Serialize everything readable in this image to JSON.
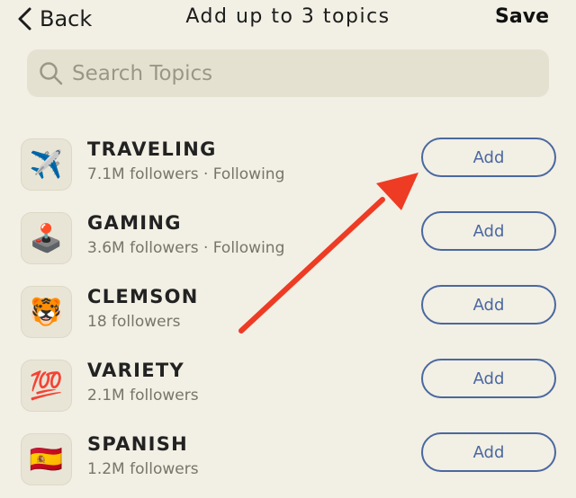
{
  "header": {
    "back_label": "Back",
    "title": "Add up to 3 topics",
    "save_label": "Save"
  },
  "search": {
    "placeholder": "Search Topics",
    "value": ""
  },
  "topics": [
    {
      "name": "TRAVELING",
      "followers": "7.1M followers · Following",
      "emoji": "✈️",
      "button": "Add"
    },
    {
      "name": "GAMING",
      "followers": "3.6M followers · Following",
      "emoji": "🕹️",
      "button": "Add"
    },
    {
      "name": "CLEMSON",
      "followers": "18 followers",
      "emoji": "🐯",
      "button": "Add"
    },
    {
      "name": "VARIETY",
      "followers": "2.1M followers",
      "emoji": "💯",
      "button": "Add"
    },
    {
      "name": "SPANISH",
      "followers": "1.2M followers",
      "emoji": "🇪🇸",
      "button": "Add"
    }
  ],
  "colors": {
    "background": "#f2efe4",
    "accent": "#4a68a0",
    "annotation_arrow": "#ee3b24"
  }
}
